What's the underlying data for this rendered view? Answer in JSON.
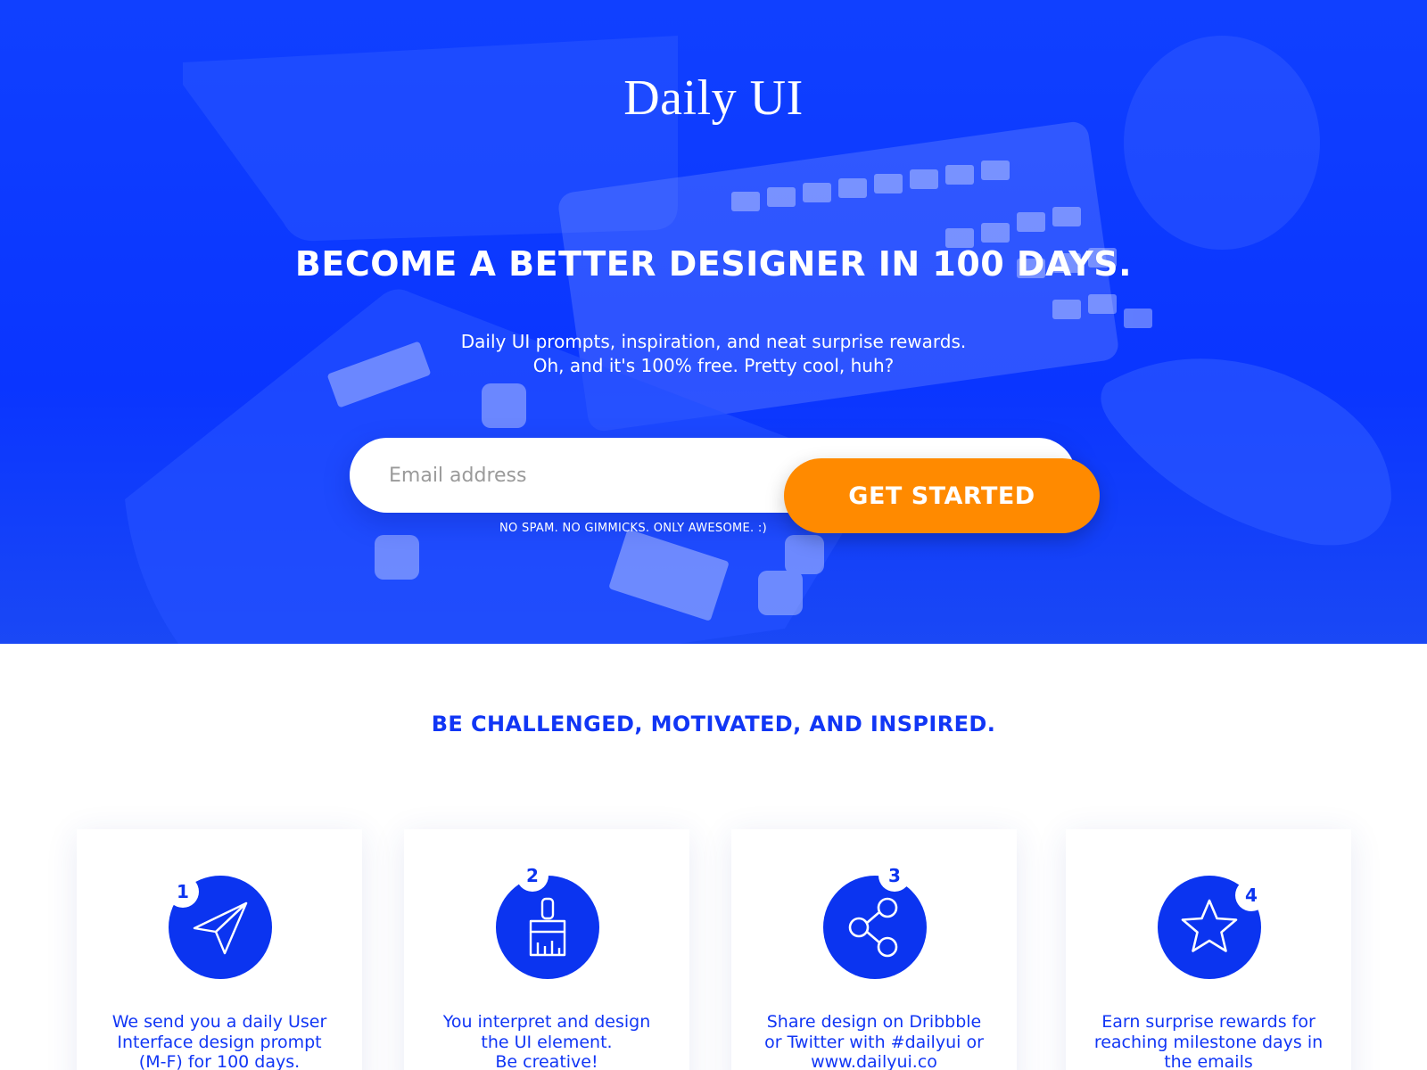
{
  "hero": {
    "logo": "Daily UI",
    "headline": "BECOME A BETTER DESIGNER IN 100 DAYS.",
    "subtitle_lines": [
      "Daily UI prompts, inspiration, and neat surprise rewards.",
      "Oh, and it's 100% free.  Pretty cool, huh?"
    ],
    "email_placeholder": "Email address",
    "cta_label": "GET STARTED",
    "disclaimer": "NO SPAM.  NO GIMMICKS.  ONLY AWESOME. :)"
  },
  "features": {
    "tagline": "BE CHALLENGED, MOTIVATED, AND INSPIRED.",
    "cards": [
      {
        "number": "1",
        "icon": "paper-plane-icon",
        "lines": [
          "We send you a daily User",
          "Interface design prompt",
          "(M-F) for 100 days."
        ]
      },
      {
        "number": "2",
        "icon": "paintbrush-icon",
        "lines": [
          "You interpret and design",
          "the UI element.",
          "Be creative!"
        ]
      },
      {
        "number": "3",
        "icon": "share-icon",
        "lines": [
          "Share design on Dribbble",
          "or Twitter with #dailyui or",
          "www.dailyui.co"
        ]
      },
      {
        "number": "4",
        "icon": "star-icon",
        "lines": [
          "Earn surprise rewards for",
          "reaching milestone days in",
          "the emails"
        ]
      }
    ]
  },
  "colors": {
    "hero_blue": "#0a35ff",
    "accent_orange": "#ff8a00",
    "text_blue": "#1136f5"
  }
}
